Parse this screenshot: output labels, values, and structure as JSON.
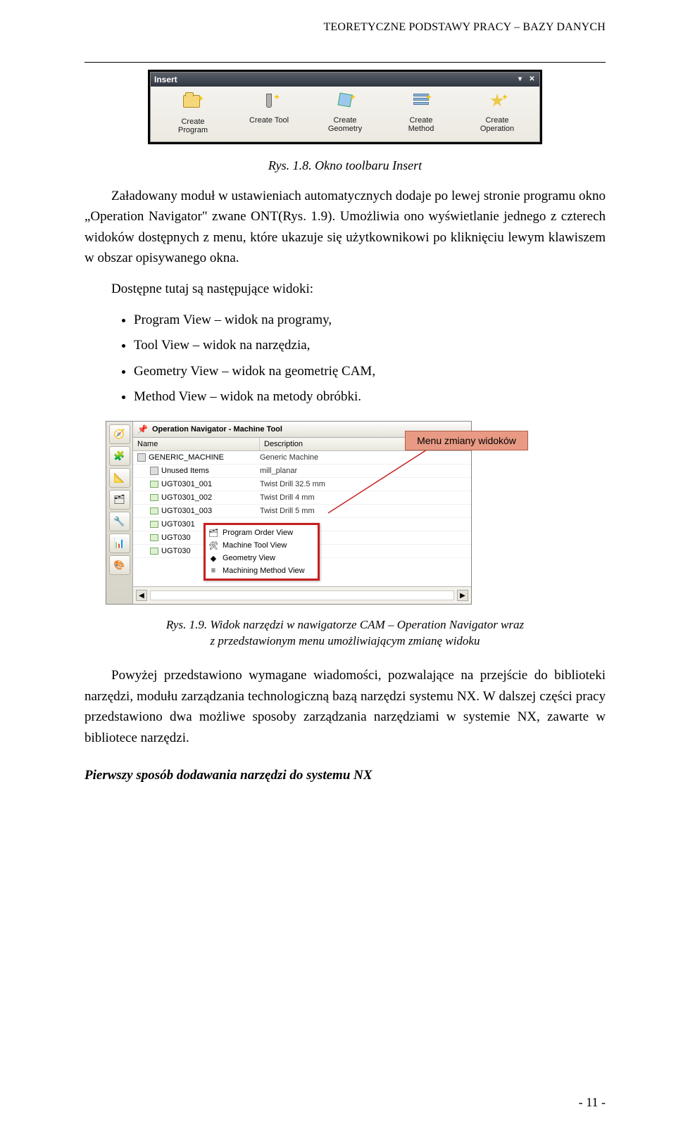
{
  "header": {
    "running_title": "TEORETYCZNE PODSTAWY PRACY – BAZY DANYCH"
  },
  "toolbar": {
    "window_title": "Insert",
    "items": [
      {
        "label_line1": "Create",
        "label_line2": "Program"
      },
      {
        "label_line1": "Create Tool",
        "label_line2": ""
      },
      {
        "label_line1": "Create",
        "label_line2": "Geometry"
      },
      {
        "label_line1": "Create",
        "label_line2": "Method"
      },
      {
        "label_line1": "Create",
        "label_line2": "Operation"
      }
    ]
  },
  "caption1": "Rys. 1.8. Okno toolbaru Insert",
  "para1": "Załadowany moduł w ustawieniach automatycznych dodaje po lewej stronie programu okno „Operation Navigator\" zwane ONT(Rys. 1.9). Umożliwia ono wyświetlanie jednego z czterech widoków dostępnych z menu, które ukazuje się użytkownikowi po kliknięciu lewym klawiszem w obszar opisywanego okna.",
  "para2": "Dostępne tutaj są następujące widoki:",
  "bullets": [
    "Program View – widok na programy,",
    "Tool View – widok na narzędzia,",
    "Geometry View – widok na geometrię CAM,",
    "Method View – widok na metody obróbki."
  ],
  "nav": {
    "panel_title": "Operation Navigator - Machine Tool",
    "col_name": "Name",
    "col_desc": "Description",
    "rows": [
      {
        "name": "GENERIC_MACHINE",
        "desc": "Generic Machine",
        "indent": 0,
        "icon": "machine"
      },
      {
        "name": "Unused Items",
        "desc": "mill_planar",
        "indent": 1,
        "icon": "unused"
      },
      {
        "name": "UGT0301_001",
        "desc": "Twist Drill 32.5 mm",
        "indent": 1,
        "icon": "tool"
      },
      {
        "name": "UGT0301_002",
        "desc": "Twist Drill 4 mm",
        "indent": 1,
        "icon": "tool"
      },
      {
        "name": "UGT0301_003",
        "desc": "Twist Drill 5 mm",
        "indent": 1,
        "icon": "tool"
      },
      {
        "name": "UGT0301",
        "desc": "",
        "indent": 1,
        "icon": "tool"
      },
      {
        "name": "UGT030",
        "desc": "",
        "indent": 1,
        "icon": "tool"
      },
      {
        "name": "UGT030",
        "desc": "",
        "indent": 1,
        "icon": "tool"
      }
    ],
    "context_menu": [
      "Program Order View",
      "Machine Tool View",
      "Geometry View",
      "Machining Method View"
    ],
    "annotation": "Menu zmiany widoków"
  },
  "caption2_l1": "Rys. 1.9. Widok narzędzi w nawigatorze CAM – Operation Navigator wraz",
  "caption2_l2": "z przedstawionym menu umożliwiającym zmianę widoku",
  "para3": "Powyżej przedstawiono wymagane wiadomości, pozwalające na przejście do biblioteki narzędzi, modułu zarządzania technologiczną bazą narzędzi systemu NX. W dalszej części pracy przedstawiono dwa możliwe sposoby zarządzania narzędziami w systemie NX, zawarte w bibliotece narzędzi.",
  "subheading": "Pierwszy sposób dodawania narzędzi do systemu NX",
  "page_number": "- 11 -"
}
